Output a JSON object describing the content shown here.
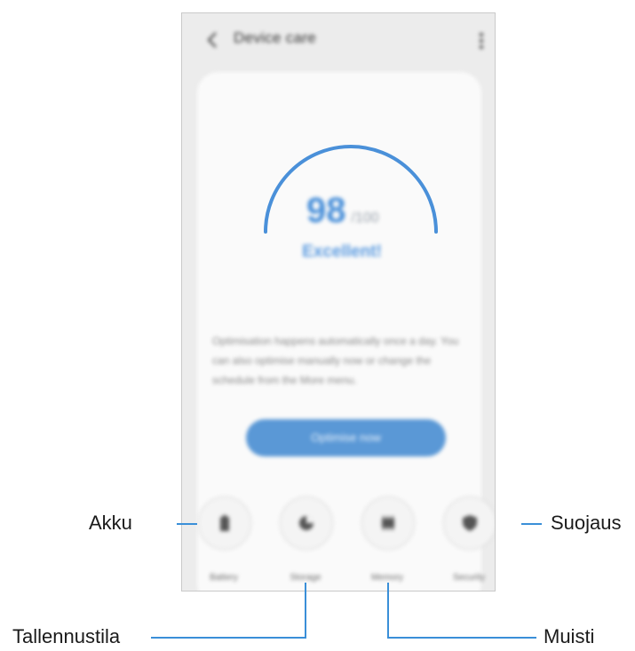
{
  "app_bar": {
    "title": "Device care"
  },
  "summary": {
    "score": "98",
    "score_unit": "/100",
    "status": "Excellent!",
    "description": "Optimisation happens automatically once a day. You can also optimise manually now or change the schedule from the More menu.",
    "optimize_button": "Optimise now"
  },
  "tiles": [
    {
      "label": "Battery",
      "icon": "battery-icon"
    },
    {
      "label": "Storage",
      "icon": "storage-pie-icon"
    },
    {
      "label": "Memory",
      "icon": "memory-chip-icon"
    },
    {
      "label": "Security",
      "icon": "shield-icon"
    }
  ],
  "callouts": {
    "battery": "Akku",
    "storage": "Tallennustila",
    "memory": "Muisti",
    "security": "Suojaus"
  },
  "colors": {
    "accent": "#5a98d6",
    "arc": "#4a90d9",
    "screen_bg": "#ececec",
    "card_bg": "#fafafa"
  }
}
